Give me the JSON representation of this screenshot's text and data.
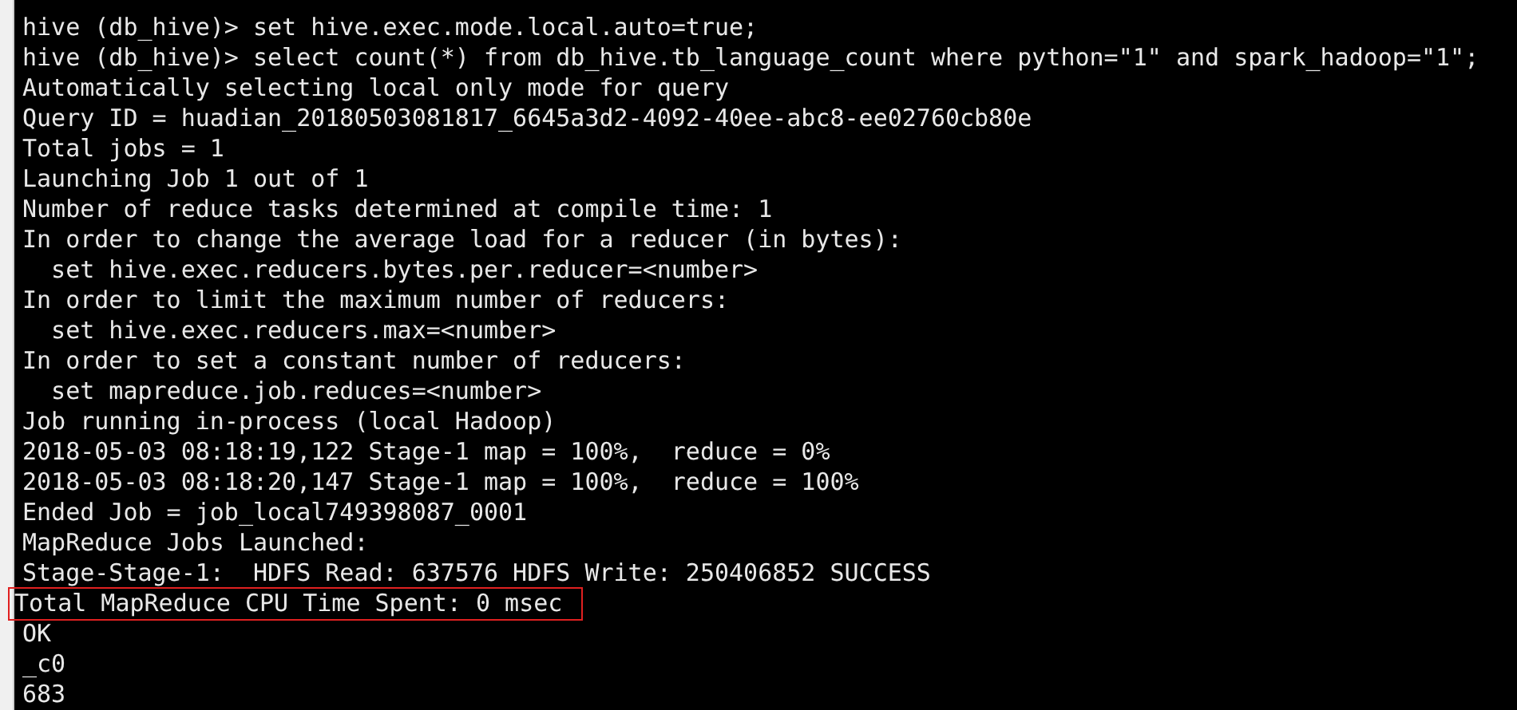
{
  "terminal": {
    "lines": [
      {
        "text": "hive (db_hive)> set hive.exec.mode.local.auto=true;",
        "highlighted": false
      },
      {
        "text": "hive (db_hive)> select count(*) from db_hive.tb_language_count where python=\"1\" and spark_hadoop=\"1\";",
        "highlighted": false
      },
      {
        "text": "Automatically selecting local only mode for query",
        "highlighted": false
      },
      {
        "text": "Query ID = huadian_20180503081817_6645a3d2-4092-40ee-abc8-ee02760cb80e",
        "highlighted": false
      },
      {
        "text": "Total jobs = 1",
        "highlighted": false
      },
      {
        "text": "Launching Job 1 out of 1",
        "highlighted": false
      },
      {
        "text": "Number of reduce tasks determined at compile time: 1",
        "highlighted": false
      },
      {
        "text": "In order to change the average load for a reducer (in bytes):",
        "highlighted": false
      },
      {
        "text": "  set hive.exec.reducers.bytes.per.reducer=<number>",
        "highlighted": false
      },
      {
        "text": "In order to limit the maximum number of reducers:",
        "highlighted": false
      },
      {
        "text": "  set hive.exec.reducers.max=<number>",
        "highlighted": false
      },
      {
        "text": "In order to set a constant number of reducers:",
        "highlighted": false
      },
      {
        "text": "  set mapreduce.job.reduces=<number>",
        "highlighted": false
      },
      {
        "text": "Job running in-process (local Hadoop)",
        "highlighted": false
      },
      {
        "text": "2018-05-03 08:18:19,122 Stage-1 map = 100%,  reduce = 0%",
        "highlighted": false
      },
      {
        "text": "2018-05-03 08:18:20,147 Stage-1 map = 100%,  reduce = 100%",
        "highlighted": false
      },
      {
        "text": "Ended Job = job_local749398087_0001",
        "highlighted": false
      },
      {
        "text": "MapReduce Jobs Launched:",
        "highlighted": false
      },
      {
        "text": "Stage-Stage-1:  HDFS Read: 637576 HDFS Write: 250406852 SUCCESS",
        "highlighted": false
      },
      {
        "text": "Total MapReduce CPU Time Spent: 0 msec",
        "highlighted": true
      },
      {
        "text": "OK",
        "highlighted": false
      },
      {
        "text": "_c0",
        "highlighted": false
      },
      {
        "text": "683",
        "highlighted": false
      }
    ]
  }
}
